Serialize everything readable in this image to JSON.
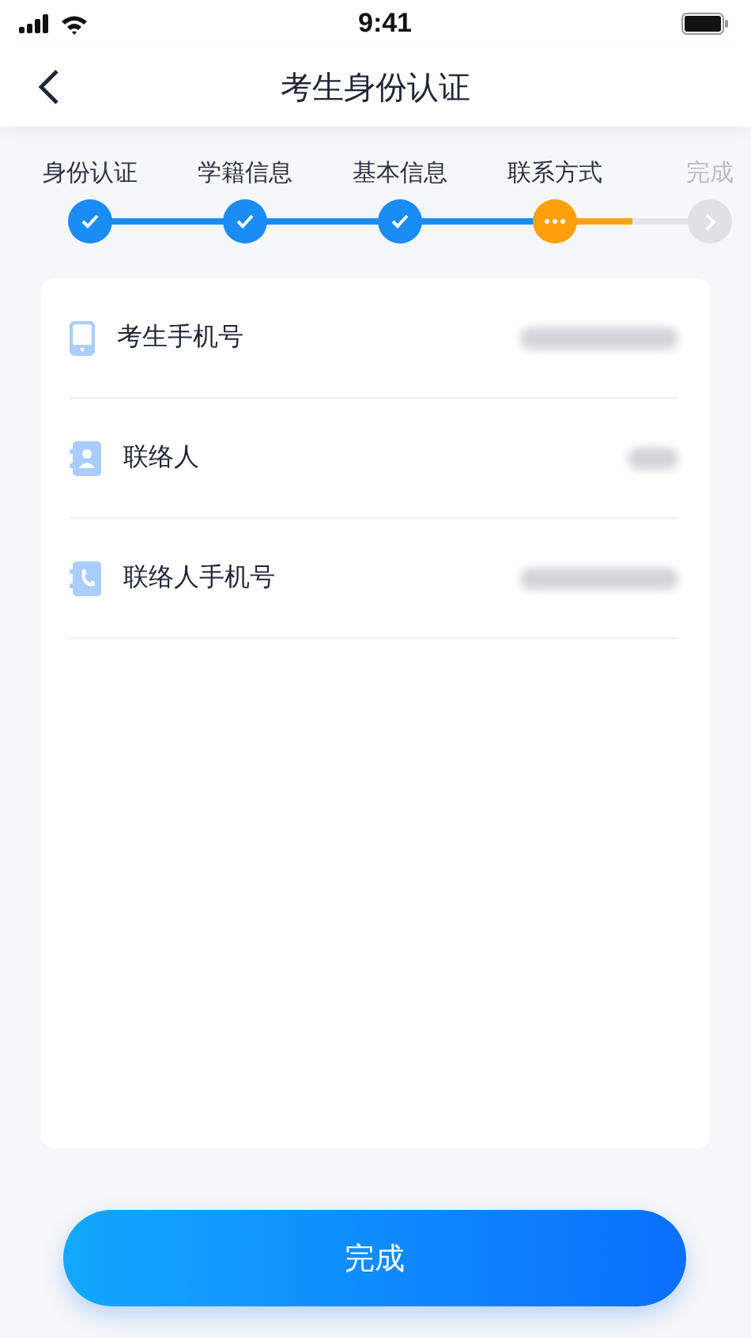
{
  "status_bar": {
    "time": "9:41"
  },
  "nav": {
    "title": "考生身份认证"
  },
  "steps": [
    {
      "label": "身份认证",
      "done": true,
      "current": false
    },
    {
      "label": "学籍信息",
      "done": true,
      "current": false
    },
    {
      "label": "基本信息",
      "done": true,
      "current": false
    },
    {
      "label": "联系方式",
      "done": false,
      "current": true
    },
    {
      "label": "完成",
      "done": false,
      "current": false
    }
  ],
  "fields": [
    {
      "label": "考生手机号",
      "kind": "mobile"
    },
    {
      "label": "联络人",
      "kind": "contact"
    },
    {
      "label": "联络人手机号",
      "kind": "phone"
    }
  ],
  "button": {
    "label": "完成"
  }
}
